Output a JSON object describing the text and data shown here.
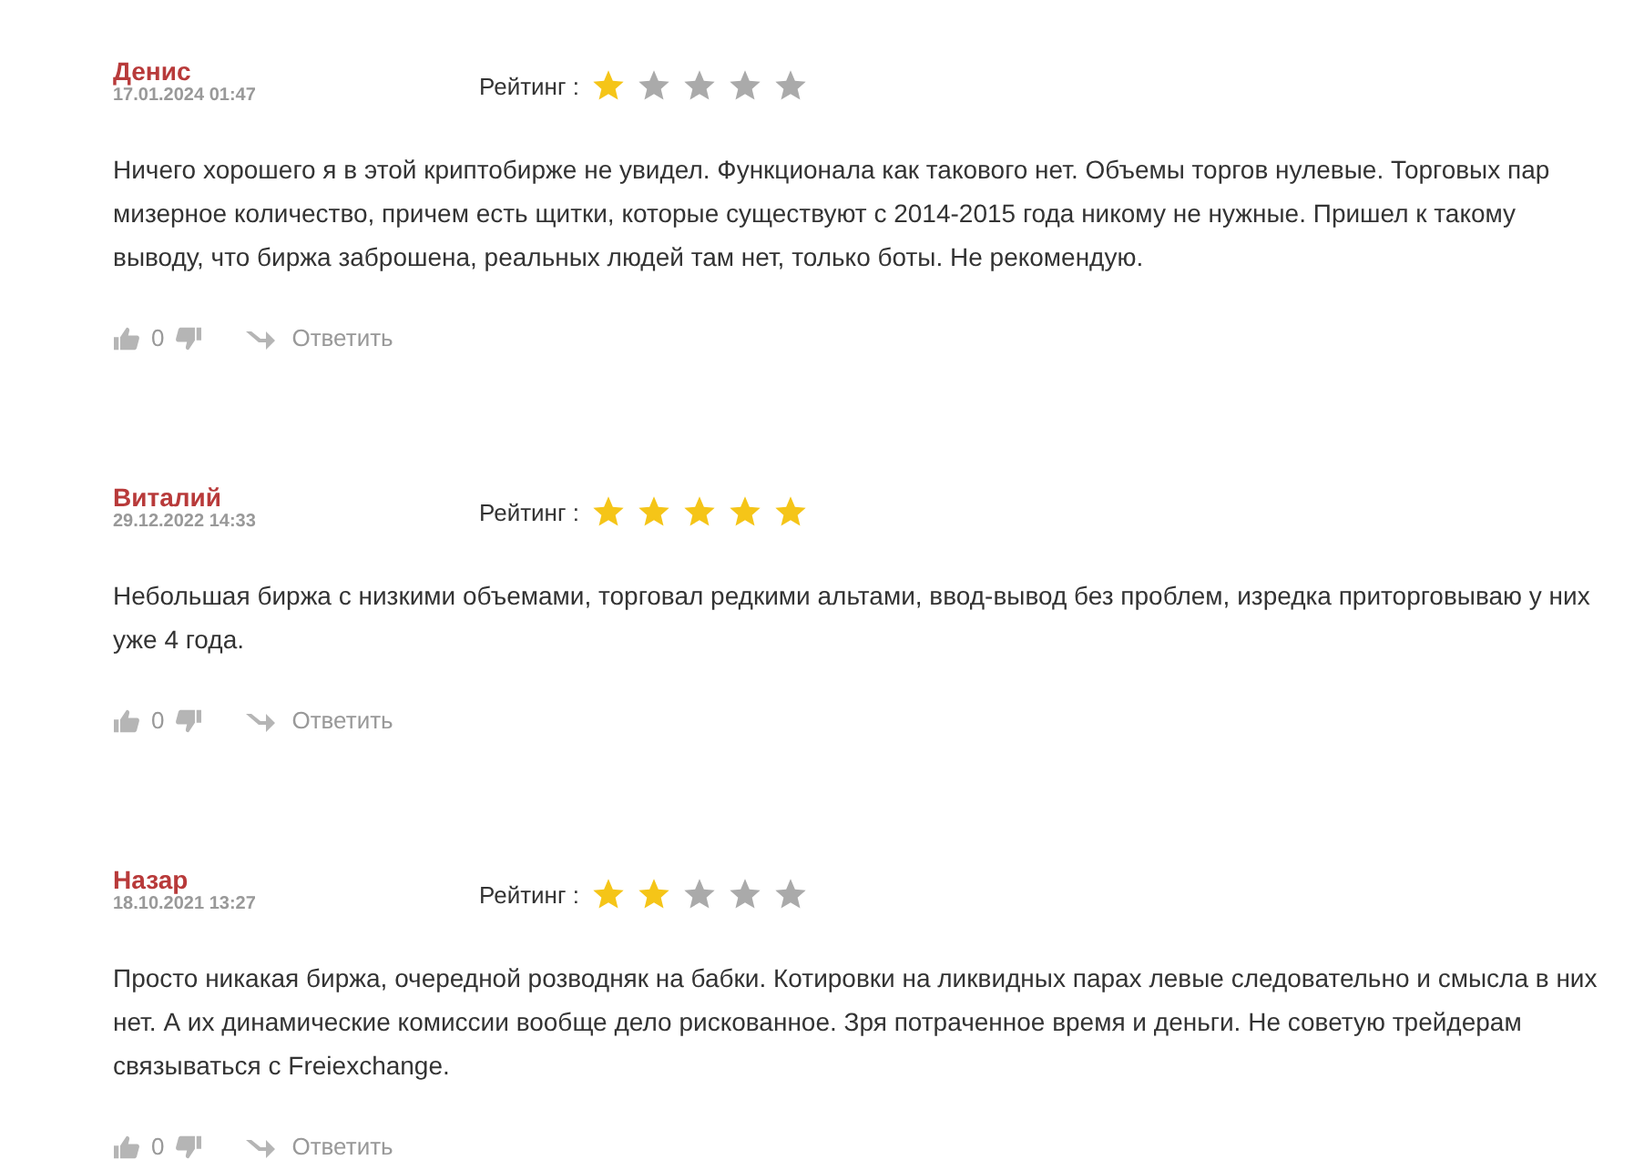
{
  "reviews": [
    {
      "author": "Денис",
      "date": "17.01.2024 01:47",
      "rating_label": "Рейтинг :",
      "stars": 1,
      "text": "Ничего хорошего я в этой криптобирже не увидел. Функционала как такового нет. Объемы торгов нулевые. Торговых пар мизерное количество, причем есть щитки, которые существуют с 2014-2015 года никому не нужные. Пришел к такому выводу, что биржа заброшена, реальных людей там нет, только боты. Не рекомендую.",
      "votes": "0",
      "reply": "Ответить"
    },
    {
      "author": "Виталий",
      "date": "29.12.2022 14:33",
      "rating_label": "Рейтинг :",
      "stars": 5,
      "text": "Небольшая биржа с низкими объемами, торговал редкими альтами, ввод-вывод без проблем, изредка приторговываю у них уже 4 года.",
      "votes": "0",
      "reply": "Ответить"
    },
    {
      "author": "Назар",
      "date": "18.10.2021 13:27",
      "rating_label": "Рейтинг :",
      "stars": 2,
      "text": "Просто никакая биржа, очередной розводняк на бабки. Котировки на ликвидных парах левые следовательно и смысла в них нет. А их динамические комиссии вообще дело рискованное. Зря потраченное время и деньги. Не советую трейдерам связываться с Freiexchange.",
      "votes": "0",
      "reply": "Ответить"
    }
  ]
}
